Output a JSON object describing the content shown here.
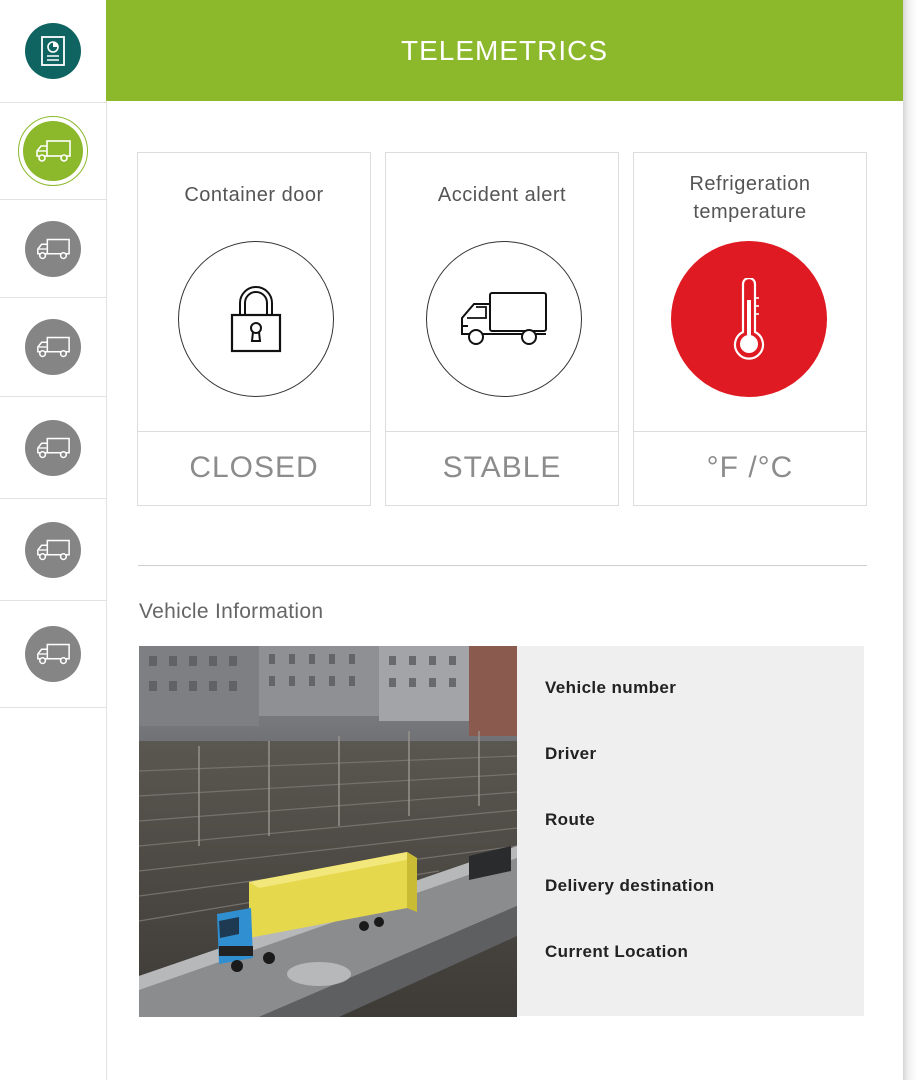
{
  "header": {
    "title": "TELEMETRICS"
  },
  "sidebar": {
    "items": [
      {
        "icon": "report-icon",
        "active": false
      },
      {
        "icon": "truck-icon",
        "active": true
      },
      {
        "icon": "truck-icon",
        "active": false
      },
      {
        "icon": "truck-icon",
        "active": false
      },
      {
        "icon": "truck-icon",
        "active": false
      },
      {
        "icon": "truck-icon",
        "active": false
      },
      {
        "icon": "truck-icon",
        "active": false
      }
    ]
  },
  "cards": [
    {
      "label": "Container door",
      "status": "CLOSED",
      "icon": "padlock-icon"
    },
    {
      "label": "Accident alert",
      "status": "STABLE",
      "icon": "truck-icon"
    },
    {
      "label_line1": "Refrigeration",
      "label_line2": "temperature",
      "status": "°F /°C",
      "icon": "thermometer-icon",
      "alert_color": "#e01a22"
    }
  ],
  "vehicle_info": {
    "title": "Vehicle Information",
    "fields": [
      "Vehicle number",
      "Driver",
      "Route",
      "Delivery destination",
      "Current Location"
    ]
  },
  "colors": {
    "brand_green": "#8cb82c",
    "report_teal": "#0f6461",
    "inactive_gray": "#858585",
    "alert_red": "#e01a22"
  }
}
